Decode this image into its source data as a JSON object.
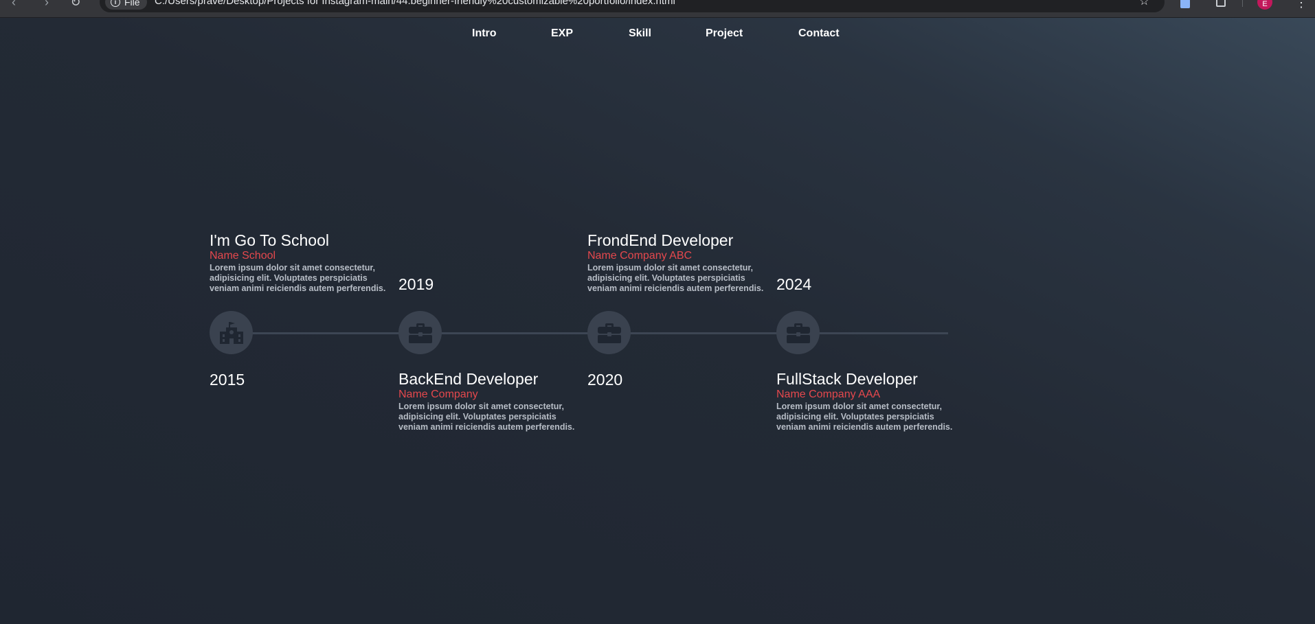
{
  "browser": {
    "chip_label": "File",
    "url": "C:/Users/prave/Desktop/Projects for Instagram-main/44.beginner-friendly%20customizable%20portfolio/index.html",
    "avatar_initial": "E"
  },
  "nav": {
    "items": [
      {
        "label": "Intro"
      },
      {
        "label": "EXP"
      },
      {
        "label": "Skill"
      },
      {
        "label": "Project"
      },
      {
        "label": "Contact"
      }
    ]
  },
  "timeline": [
    {
      "title": "I'm Go To School",
      "company": "Name School",
      "description": "Lorem ipsum dolor sit amet consectetur, adipisicing elit. Voluptates perspiciatis veniam animi reiciendis autem perferendis.",
      "year": "2015",
      "icon": "school-icon"
    },
    {
      "title": "BackEnd Developer",
      "company": "Name Company",
      "description": "Lorem ipsum dolor sit amet consectetur, adipisicing elit. Voluptates perspiciatis veniam animi reiciendis autem perferendis.",
      "year": "2019",
      "icon": "briefcase-icon"
    },
    {
      "title": "FrondEnd Developer",
      "company": "Name Company ABC",
      "description": "Lorem ipsum dolor sit amet consectetur, adipisicing elit. Voluptates perspiciatis veniam animi reiciendis autem perferendis.",
      "year": "2020",
      "icon": "briefcase-icon"
    },
    {
      "title": "FullStack Developer",
      "company": "Name Company AAA",
      "description": "Lorem ipsum dolor sit amet consectetur, adipisicing elit. Voluptates perspiciatis veniam animi reiciendis autem perferendis.",
      "year": "2024",
      "icon": "briefcase-icon"
    }
  ],
  "colors": {
    "accent": "#e5484d",
    "node_bg": "#3a424f",
    "line": "#3d4654"
  }
}
